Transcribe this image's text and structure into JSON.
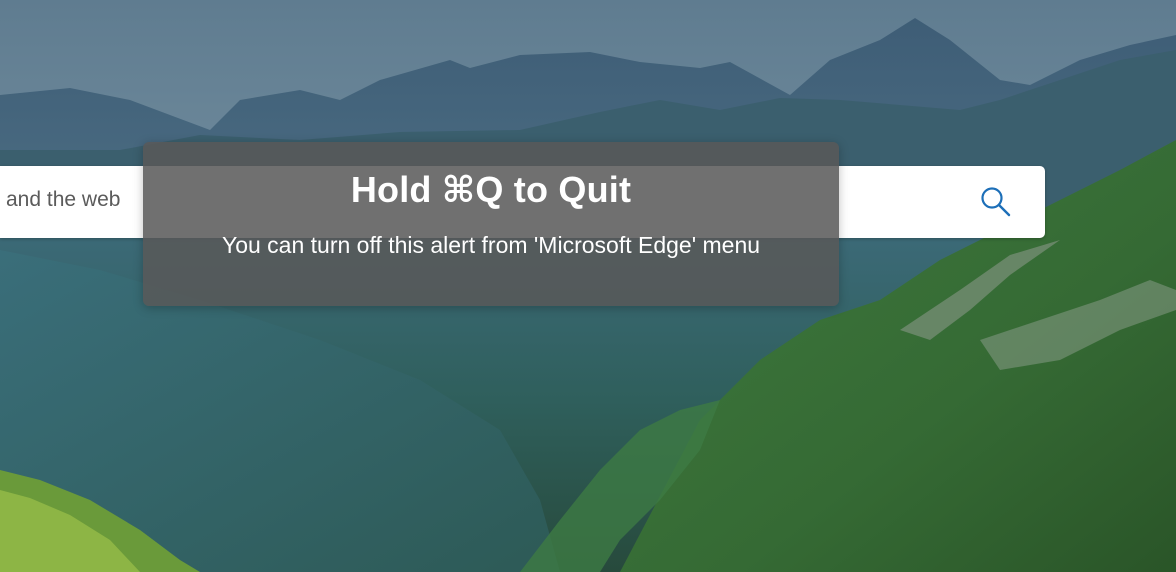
{
  "background": {
    "description_icon": "mountain-landscape-image"
  },
  "search": {
    "value": "and the web",
    "icon": "search-icon",
    "accent_color": "#1d6fb8"
  },
  "alert": {
    "title": "Hold ⌘Q to Quit",
    "message": "You can turn off this alert from 'Microsoft Edge' menu"
  }
}
